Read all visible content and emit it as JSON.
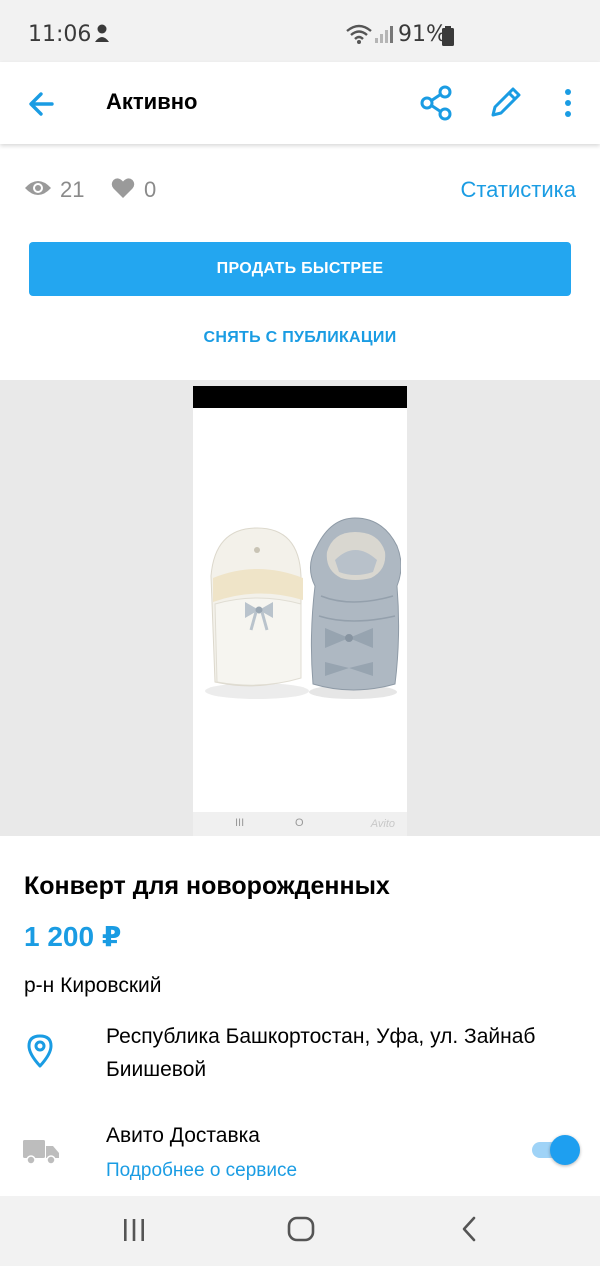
{
  "status_bar": {
    "time": "11:06",
    "battery": "91%"
  },
  "app_bar": {
    "title": "Активно"
  },
  "stats": {
    "views": "21",
    "likes": "0",
    "statistics_link": "Статистика"
  },
  "actions": {
    "sell_faster": "ПРОДАТЬ БЫСТРЕЕ",
    "unpublish": "СНЯТЬ С ПУБЛИКАЦИИ"
  },
  "photo": {
    "navbar_items": [
      "III",
      "O"
    ],
    "watermark": "Avito"
  },
  "listing": {
    "title": "Конверт для новорожденных",
    "price": "1 200 ₽",
    "district": "р-н Кировский",
    "address": "Республика Башкортостан, Уфа, ул. Зайнаб Биишевой"
  },
  "delivery": {
    "title": "Авито Доставка",
    "link": "Подробнее о сервисе",
    "enabled": true
  },
  "colors": {
    "accent": "#1a9ce3",
    "button": "#23a6f0",
    "muted": "#8a8a8a"
  }
}
